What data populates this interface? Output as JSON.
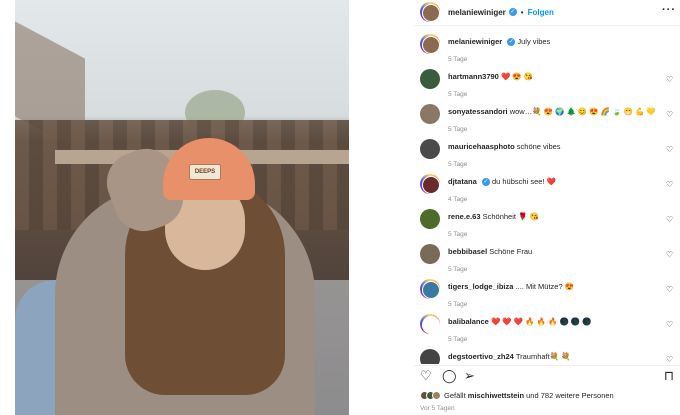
{
  "post": {
    "username": "melaniewiniger",
    "follow_label": "Folgen",
    "more_label": "···",
    "caption": "July vibes",
    "caption_time": "5 Tage",
    "photo_patch_text": "DEEPS"
  },
  "comments": [
    {
      "user": "hartmann3790",
      "text": "❤️ 😍 😘",
      "time": "5 Tage",
      "color": "#3b5b3e"
    },
    {
      "user": "sonyatessandori",
      "text": "wow…💐 😍 🌍 🌲 😊 😍 🌈 🍃 😁 💪 💛",
      "time": "5 Tage",
      "color": "#8b7766"
    },
    {
      "user": "mauricehaasphoto",
      "text": "schöne vibes",
      "time": "5 Tage",
      "color": "#4a4a4a"
    },
    {
      "user": "djtatana",
      "text": "du hübschi see! ❤️",
      "time": "4 Tage",
      "color": "#6a2a2a",
      "verified": true
    },
    {
      "user": "rene.e.63",
      "text": "Schönheit 🌹 😘",
      "time": "5 Tage",
      "color": "#4d6b2a"
    },
    {
      "user": "bebbibasel",
      "text": "Schöne Frau",
      "time": "5 Tage",
      "color": "#7a6a5a"
    },
    {
      "user": "tigers_lodge_ibiza",
      "text": ".... Mit Mütze? 😍",
      "time": "5 Tage",
      "color": "#3a7aa0"
    },
    {
      "user": "balibalance",
      "text": "❤️ ❤️ ❤️ 🔥 🔥 🔥 🌑 🌑 🌑",
      "time": "5 Tage",
      "color": "#ffffff"
    },
    {
      "user": "degstoertivo_zh24",
      "text": "Traumhaft💐 💐",
      "time": "",
      "color": "#444444"
    }
  ],
  "actions": {
    "like_icon": "heart-icon",
    "comment_icon": "comment-icon",
    "share_icon": "share-icon",
    "save_icon": "bookmark-icon"
  },
  "likes": {
    "prefix": "Gefällt",
    "user": "mischiwettstein",
    "suffix": "und 782 weitere Personen"
  },
  "posted": "Vor 5 Tagen"
}
